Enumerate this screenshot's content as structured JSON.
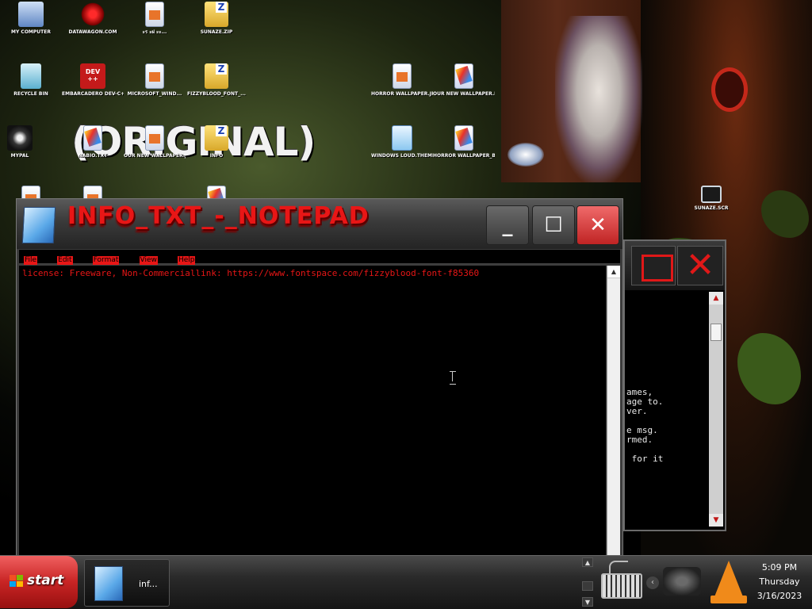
{
  "desktop": {
    "wallpaper_text": "(ORIGINAL)",
    "icons": [
      {
        "label": "MY COMPUTER",
        "icon": "computer-icon"
      },
      {
        "label": "DATAWAGON.COM",
        "icon": "web-shortcut-icon"
      },
      {
        "label": "ะร ะฝ ะะ...",
        "icon": "file-icon"
      },
      {
        "label": "SUNAZE.ZIP",
        "icon": "zip-icon"
      },
      {
        "label": "RECYCLE BIN",
        "icon": "recycle-bin-icon"
      },
      {
        "label": "EMBARCADERO DEV-C++",
        "icon": "devcpp-icon"
      },
      {
        "label": "MICROSOFT_WIND...",
        "icon": "file-icon"
      },
      {
        "label": "FIZZYBLOOD_FONT_...",
        "icon": "zip-icon"
      },
      {
        "label": "HORROR WALLPAPER.JPG",
        "icon": "image-file-icon"
      },
      {
        "label": "OUR NEW WALLPAPER.BMP",
        "icon": "image-file-icon"
      },
      {
        "label": "MYPAL",
        "icon": "raccoon-icon"
      },
      {
        "label": "NABIO.TXT",
        "icon": "file-icon"
      },
      {
        "label": "OUR NEW WALLPAPER.JPG",
        "icon": "file-icon"
      },
      {
        "label": "INFO",
        "icon": "folder-icon"
      },
      {
        "label": "WINDOWS LOUD.THEMEPACK",
        "icon": "theme-icon"
      },
      {
        "label": "HORROR WALLPAPER_B...",
        "icon": "image-file-icon"
      },
      {
        "label": "SUNAZE.SCR",
        "icon": "monitor-icon"
      }
    ]
  },
  "bg_window": {
    "lines": [
      "ames,",
      "age to.",
      "ver.",
      "",
      "e msg.",
      "rmed.",
      "",
      " for it"
    ]
  },
  "notepad": {
    "title": "INFO_TXT_-_NOTEPAD",
    "menu": [
      "File",
      "Edit",
      "Format",
      "View",
      "Help"
    ],
    "content": "license: Freeware, Non-Commerciallink: https://www.fontspace.com/fizzyblood-font-f85360",
    "buttons": {
      "minimize": "minimize",
      "maximize": "maximize",
      "close": "close"
    }
  },
  "taskbar": {
    "start_label": "start",
    "task_label": "inf...",
    "clock_time": "5:09 PM",
    "clock_day": "Thursday",
    "clock_date": "3/16/2023"
  },
  "colors": {
    "accent_red": "#e81616",
    "start_red": "#c82424",
    "taskbar": "#2a2a2a"
  }
}
